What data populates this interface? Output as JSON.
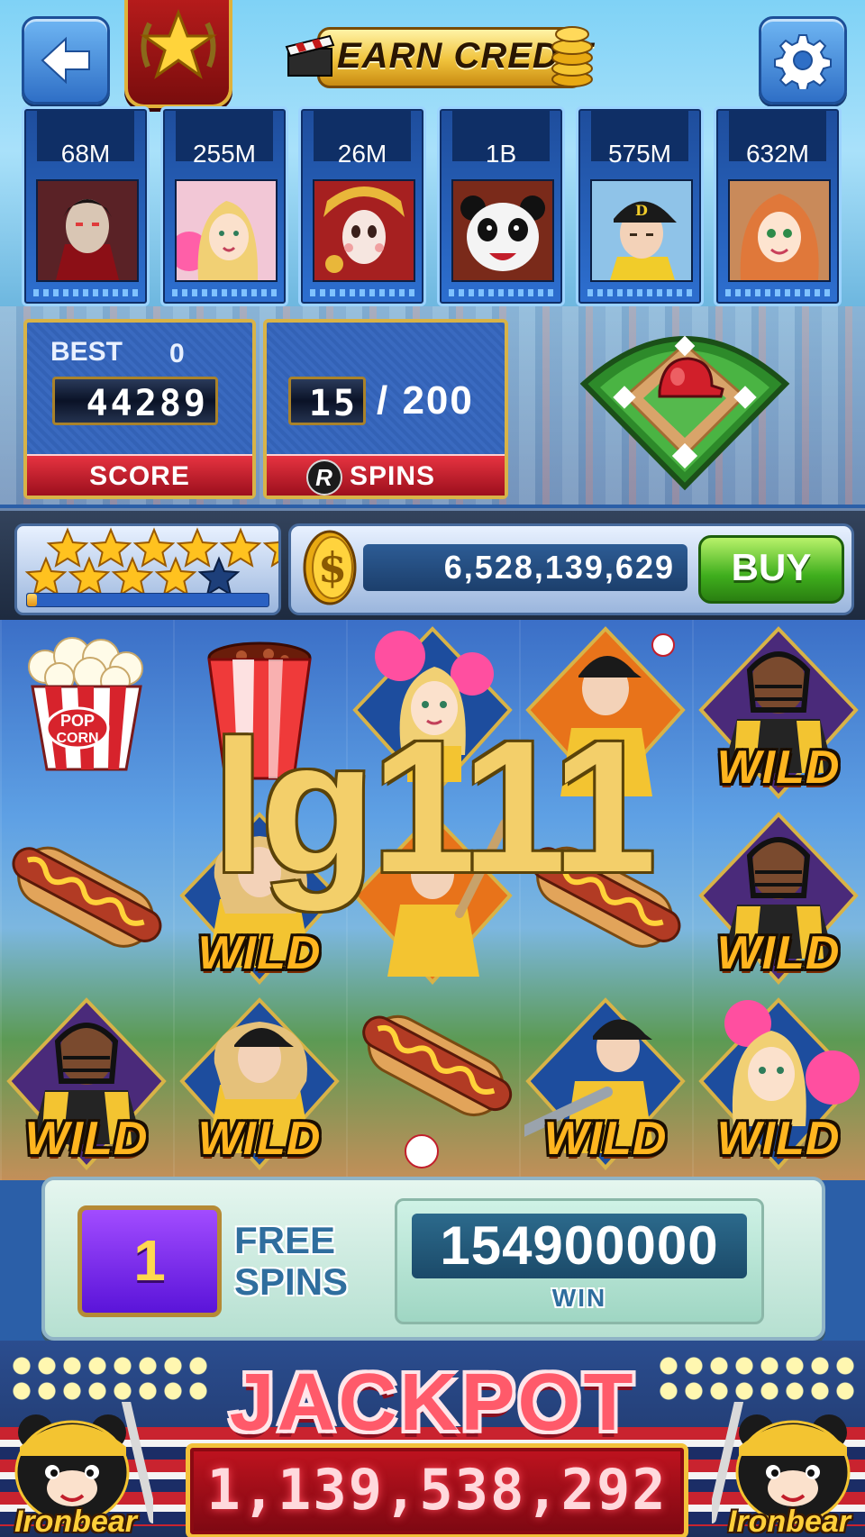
{
  "header": {
    "back_icon": "back-arrow-icon",
    "rank_icon": "gold-star-laurel-icon",
    "earn_credit_label": "EARN CREDIT",
    "settings_icon": "gear-icon"
  },
  "players": [
    {
      "credit": "68M",
      "avatar": "vampire-avatar"
    },
    {
      "credit": "255M",
      "avatar": "cheerleader-avatar"
    },
    {
      "credit": "26M",
      "avatar": "opera-girl-avatar"
    },
    {
      "credit": "1B",
      "avatar": "panda-avatar"
    },
    {
      "credit": "575M",
      "avatar": "baseball-player-avatar"
    },
    {
      "credit": "632M",
      "avatar": "redhead-girl-avatar"
    }
  ],
  "score_panel": {
    "best_label": "BEST",
    "best_value": "0",
    "score": "44289",
    "footer_label": "SCORE"
  },
  "spins_panel": {
    "current": "15",
    "total": "/ 200",
    "logo": "R",
    "footer_label": "SPINS"
  },
  "bonus_icon": "baseball-diamond-helmet-icon",
  "status": {
    "stars_filled": 10,
    "stars_total": 11,
    "xp_fraction": 0.04,
    "balance": "6,528,139,629",
    "buy_label": "BUY",
    "coin_icon": "dollar-coin-icon"
  },
  "reels": {
    "wild_text": "WILD",
    "grid": [
      [
        "popcorn",
        "soda",
        "cheerleader",
        "pitcher",
        "catcher-wild"
      ],
      [
        "hotdog",
        "pitcher-wild",
        "batter",
        "hotdog",
        "catcher-wild"
      ],
      [
        "catcher-wild",
        "pitcher-wild",
        "hotdog",
        "batter-wild",
        "cheerleader-wild"
      ]
    ]
  },
  "watermark": "lg111",
  "win_panel": {
    "free_spins_count": "1",
    "free_spins_label_1": "FREE",
    "free_spins_label_2": "SPINS",
    "win_amount": "154900000",
    "win_label": "WIN"
  },
  "jackpot": {
    "title": "JACKPOT",
    "amount": "1,139,538,292",
    "mascot_name": "Ironbear"
  },
  "colors": {
    "accent_gold": "#f3c13a",
    "panel_blue": "#3362b6",
    "jackpot_red": "#c0131f",
    "buy_green": "#3fae1d"
  }
}
